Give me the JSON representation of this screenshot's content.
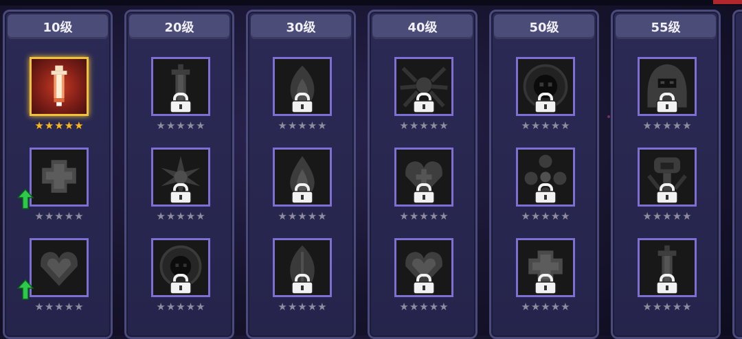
{
  "colors": {
    "frame_locked": "#7d6fd4",
    "frame_unlocked": "#f2c23a",
    "star_gold": "#f5b622",
    "star_gray": "#8d8d9e",
    "upgrade_arrow": "#2ec94a"
  },
  "columns": [
    {
      "level": "10级",
      "slots": [
        {
          "icon": "crystal-sword-icon",
          "locked": false,
          "stars": 5,
          "gold": true,
          "upgrade": false
        },
        {
          "icon": "cross-shield-icon",
          "locked": false,
          "stars": 5,
          "gold": false,
          "upgrade": true
        },
        {
          "icon": "heart-icon",
          "locked": false,
          "stars": 5,
          "gold": false,
          "upgrade": true
        }
      ]
    },
    {
      "level": "20级",
      "slots": [
        {
          "icon": "dagger-icon",
          "locked": true,
          "stars": 5
        },
        {
          "icon": "starburst-icon",
          "locked": true,
          "stars": 5
        },
        {
          "icon": "skull-hood-icon",
          "locked": true,
          "stars": 5
        }
      ]
    },
    {
      "level": "30级",
      "slots": [
        {
          "icon": "flame-icon",
          "locked": true,
          "stars": 5
        },
        {
          "icon": "drop-icon",
          "locked": true,
          "stars": 5
        },
        {
          "icon": "leaf-icon",
          "locked": true,
          "stars": 5
        }
      ]
    },
    {
      "level": "40级",
      "slots": [
        {
          "icon": "spider-icon",
          "locked": true,
          "stars": 5
        },
        {
          "icon": "heart-plus-icon",
          "locked": true,
          "stars": 5
        },
        {
          "icon": "heart-icon",
          "locked": true,
          "stars": 5
        }
      ]
    },
    {
      "level": "50级",
      "slots": [
        {
          "icon": "ghost-skull-icon",
          "locked": true,
          "stars": 5
        },
        {
          "icon": "orb-cluster-icon",
          "locked": true,
          "stars": 5
        },
        {
          "icon": "cross-shield-icon",
          "locked": true,
          "stars": 5
        }
      ]
    },
    {
      "level": "55级",
      "slots": [
        {
          "icon": "hooded-figure-icon",
          "locked": true,
          "stars": 5
        },
        {
          "icon": "totem-icon",
          "locked": true,
          "stars": 5
        },
        {
          "icon": "dagger-icon",
          "locked": true,
          "stars": 5
        }
      ]
    }
  ]
}
